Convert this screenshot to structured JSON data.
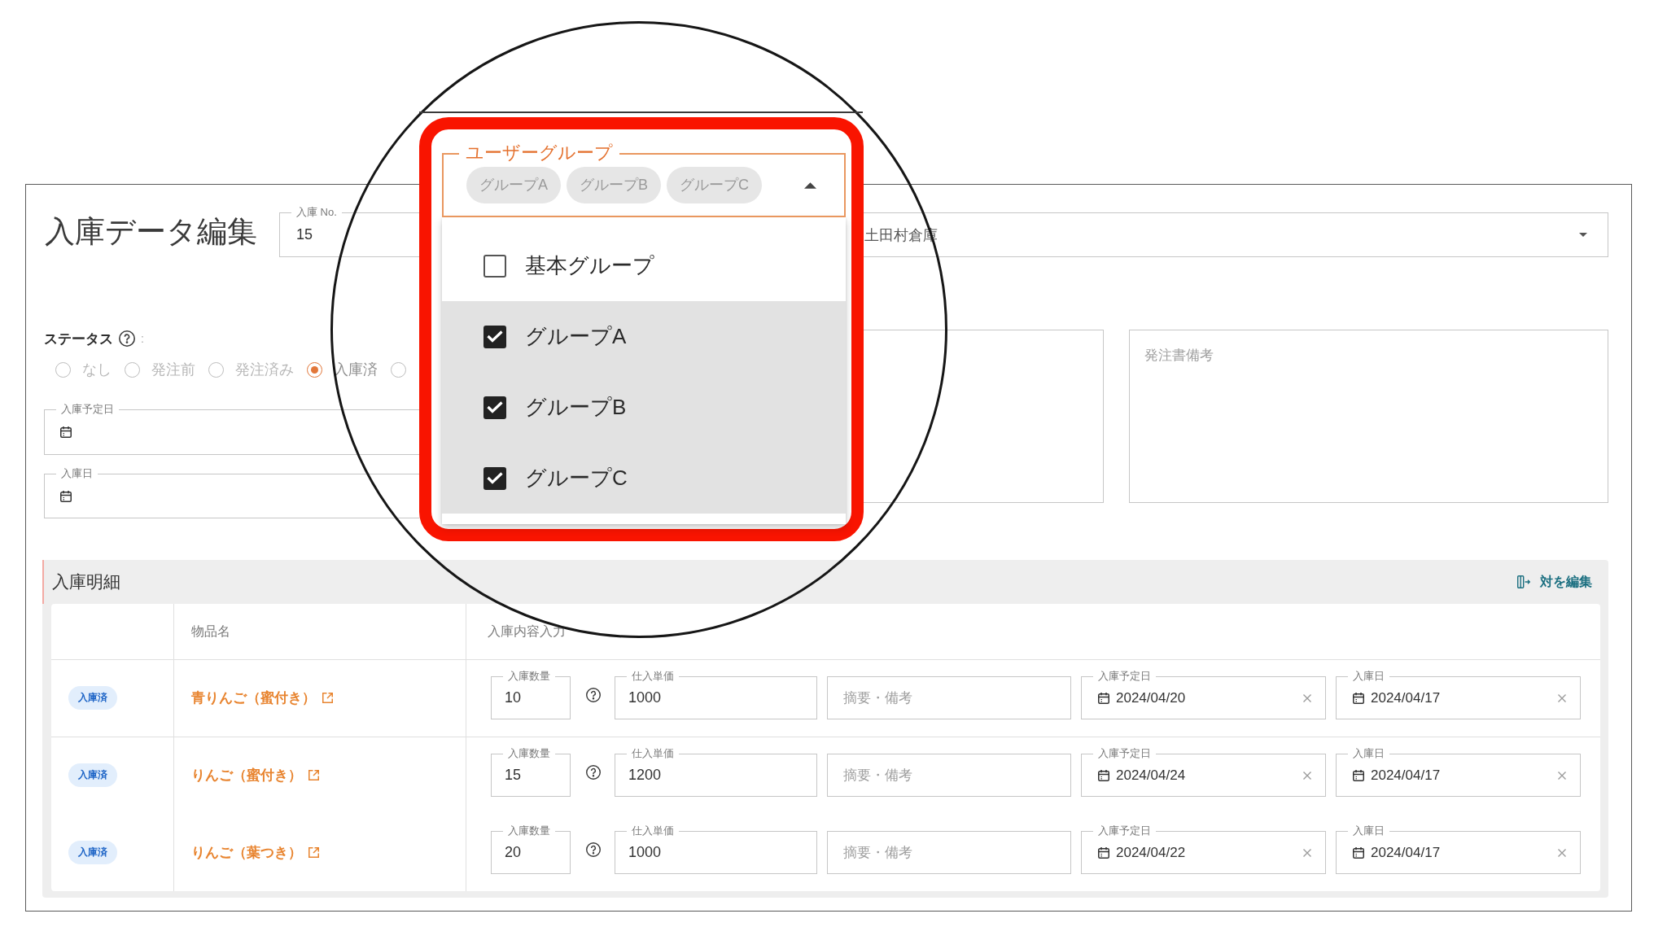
{
  "page": {
    "title": "入庫データ編集"
  },
  "form": {
    "receipt_no": {
      "label": "入庫 No.",
      "value": "15"
    },
    "warehouse": {
      "value": "土田村倉庫"
    },
    "status": {
      "label": "ステータス",
      "colon": ":",
      "options": [
        {
          "label": "なし",
          "selected": false
        },
        {
          "label": "発注前",
          "selected": false
        },
        {
          "label": "発注済み",
          "selected": false
        },
        {
          "label": "入庫済",
          "selected": true
        },
        {
          "selected": false
        }
      ]
    },
    "scheduled_date": {
      "label": "入庫予定日"
    },
    "received_date": {
      "label": "入庫日"
    },
    "order_note": {
      "placeholder": "発注書備考"
    }
  },
  "details": {
    "title": "入庫明細",
    "edit_columns": "対を編集",
    "columns": [
      "物品名",
      "入庫内容入力"
    ],
    "rows": [
      {
        "status": "入庫済",
        "item": "青りんご（蜜付き）",
        "quantity": {
          "label": "入庫数量",
          "value": "10"
        },
        "unit_price": {
          "label": "仕入単価",
          "value": "1000"
        },
        "remarks": {
          "placeholder": "摘要・備考"
        },
        "scheduled_date": {
          "label": "入庫予定日",
          "value": "2024/04/20"
        },
        "received_date": {
          "label": "入庫日",
          "value": "2024/04/17"
        }
      },
      {
        "status": "入庫済",
        "item": "りんご（蜜付き）",
        "quantity": {
          "label": "入庫数量",
          "value": "15"
        },
        "unit_price": {
          "label": "仕入単価",
          "value": "1200"
        },
        "remarks": {
          "placeholder": "摘要・備考"
        },
        "scheduled_date": {
          "label": "入庫予定日",
          "value": "2024/04/24"
        },
        "received_date": {
          "label": "入庫日",
          "value": "2024/04/17"
        }
      },
      {
        "status": "入庫済",
        "item": "りんご（葉つき）",
        "quantity": {
          "label": "入庫数量",
          "value": "20"
        },
        "unit_price": {
          "label": "仕入単価",
          "value": "1000"
        },
        "remarks": {
          "placeholder": "摘要・備考"
        },
        "scheduled_date": {
          "label": "入庫予定日",
          "value": "2024/04/22"
        },
        "received_date": {
          "label": "入庫日",
          "value": "2024/04/17"
        }
      }
    ]
  },
  "callout": {
    "user_group": {
      "label": "ユーザーグループ",
      "chips": [
        "グループA",
        "グループB",
        "グループC"
      ],
      "expanded": true,
      "options": [
        {
          "label": "基本グループ",
          "checked": false
        },
        {
          "label": "グループA",
          "checked": true
        },
        {
          "label": "グループB",
          "checked": true
        },
        {
          "label": "グループC",
          "checked": true
        }
      ]
    }
  }
}
